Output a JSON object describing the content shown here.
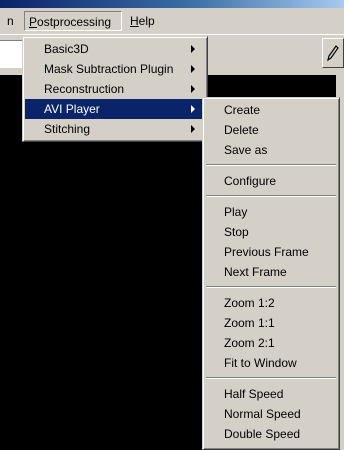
{
  "menubar": {
    "partial_left": "n",
    "postprocessing": "Postprocessing",
    "postprocessing_underline": "P",
    "postprocessing_rest": "ostprocessing",
    "help_underline": "H",
    "help_rest": "elp"
  },
  "postprocessing_menu": {
    "items": [
      {
        "label": "Basic3D",
        "submenu": true
      },
      {
        "label": "Mask Subtraction Plugin",
        "submenu": true
      },
      {
        "label": "Reconstruction",
        "submenu": true
      },
      {
        "label": "AVI Player",
        "submenu": true,
        "selected": true
      },
      {
        "label": "Stitching",
        "submenu": true
      }
    ]
  },
  "avi_player_submenu": {
    "group1": [
      "Create",
      "Delete",
      "Save as"
    ],
    "group2": [
      "Configure"
    ],
    "group3": [
      "Play",
      "Stop",
      "Previous Frame",
      "Next Frame"
    ],
    "group4": [
      "Zoom 1:2",
      "Zoom 1:1",
      "Zoom 2:1",
      "Fit to Window"
    ],
    "group5": [
      "Half Speed",
      "Normal Speed",
      "Double Speed"
    ]
  },
  "colors": {
    "menu_bg": "#d4d0c8",
    "selection": "#0a246a",
    "canvas": "#000000"
  }
}
